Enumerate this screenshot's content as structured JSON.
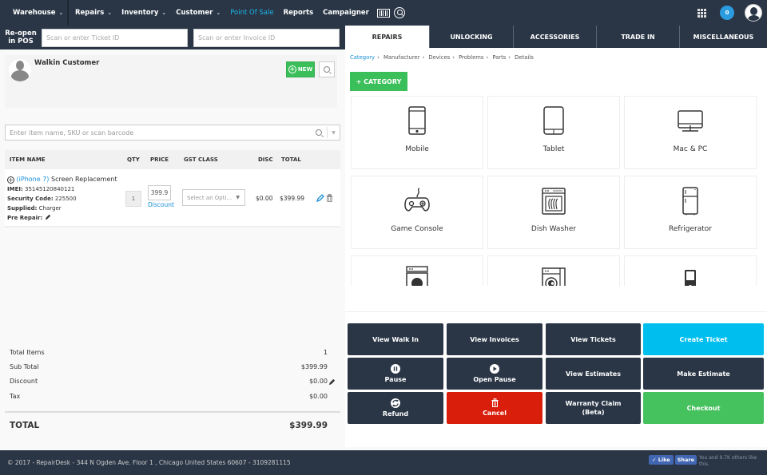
{
  "topnav": {
    "warehouse": "Warehouse",
    "items": [
      {
        "label": "Repairs",
        "dropdown": true
      },
      {
        "label": "Inventory",
        "dropdown": true
      },
      {
        "label": "Customer",
        "dropdown": true
      },
      {
        "label": "Point Of Sale",
        "dropdown": false,
        "active": true
      },
      {
        "label": "Reports",
        "dropdown": false
      },
      {
        "label": "Campaigner",
        "dropdown": false
      }
    ],
    "notification_count": "0",
    "icons": [
      "barcode-icon",
      "search-icon",
      "apps-grid-icon",
      "user-avatar-icon"
    ]
  },
  "reopen": {
    "label_line1": "Re-open",
    "label_line2": "in POS",
    "ticket_placeholder": "Scan or enter Ticket ID",
    "ticket_value": "",
    "invoice_placeholder": "Scan or enter Invoice ID",
    "invoice_value": ""
  },
  "customer": {
    "name": "Walkin Customer",
    "new_label": "NEW"
  },
  "item_search": {
    "placeholder": "Enter item name, SKU or scan barcode",
    "value": ""
  },
  "table": {
    "headers": {
      "item_name": "ITEM NAME",
      "qty": "QTY",
      "price": "PRICE",
      "gst_class": "GST CLASS",
      "disc": "DISC",
      "total": "TOTAL"
    },
    "rows": [
      {
        "device": "(iPhone 7)",
        "service": "Screen Replacement",
        "imei_label": "IMEI:",
        "imei": "35145120840121",
        "security_label": "Security Code:",
        "security": "225500",
        "supplied_label": "Supplied:",
        "supplied": "Charger",
        "prerepair_label": "Pre Repair:",
        "qty": "1",
        "price": "399.9",
        "discount_link": "Discount",
        "gst_placeholder": "Select an Opti...",
        "disc": "$0.00",
        "total": "$399.99"
      }
    ]
  },
  "totals": {
    "total_items_label": "Total Items",
    "total_items": "1",
    "sub_total_label": "Sub Total",
    "sub_total": "$399.99",
    "discount_label": "Discount",
    "discount": "$0.00",
    "tax_label": "Tax",
    "tax": "$0.00",
    "grand_total_label": "TOTAL",
    "grand_total": "$399.99"
  },
  "tabs": [
    {
      "label": "REPAIRS",
      "active": true
    },
    {
      "label": "UNLOCKING"
    },
    {
      "label": "ACCESSORIES"
    },
    {
      "label": "TRADE IN"
    },
    {
      "label": "MISCELLANEOUS"
    }
  ],
  "breadcrumb": [
    "Category",
    "Manufacturer",
    "Devices",
    "Problems",
    "Parts",
    "Details"
  ],
  "category_button": "+ CATEGORY",
  "categories": [
    {
      "label": "Mobile",
      "icon": "mobile-icon"
    },
    {
      "label": "Tablet",
      "icon": "tablet-icon"
    },
    {
      "label": "Mac & PC",
      "icon": "desktop-icon"
    },
    {
      "label": "Game Console",
      "icon": "gamepad-icon"
    },
    {
      "label": "Dish Washer",
      "icon": "dishwasher-icon"
    },
    {
      "label": "Refrigerator",
      "icon": "refrigerator-icon"
    },
    {
      "label": "",
      "icon": "dryer-icon"
    },
    {
      "label": "",
      "icon": "washing-machine-icon"
    },
    {
      "label": "",
      "icon": "music-player-icon"
    }
  ],
  "actions": [
    {
      "label": "View Walk In"
    },
    {
      "label": "View Invoices"
    },
    {
      "label": "View Tickets"
    },
    {
      "label": "Create Ticket",
      "color": "#00bfee"
    },
    {
      "label": "Pause",
      "icon": "pause-icon"
    },
    {
      "label": "Open Pause",
      "icon": "play-icon"
    },
    {
      "label": "View Estimates"
    },
    {
      "label": "Make Estimate"
    },
    {
      "label": "Refund",
      "icon": "refund-icon"
    },
    {
      "label": "Cancel",
      "icon": "trash-icon",
      "color": "#d91f0b"
    },
    {
      "label": "Warranty Claim\n(Beta)",
      "line1": "Warranty Claim",
      "line2": "(Beta)"
    },
    {
      "label": "Checkout",
      "color": "#45c15e"
    }
  ],
  "footer": {
    "text": "© 2017 - RepairDesk - 344 N Ogden Ave. Floor 1 , Chicago United States 60607 - 3109281115",
    "fb_like": "✓ Like",
    "fb_share": "Share",
    "fb_text": "You and 9.7K others like this."
  },
  "colors": {
    "navy": "#2a3646",
    "accent_blue": "#1ab4e8",
    "green": "#3bbf5a",
    "cyan": "#00bfee",
    "red": "#d91f0b"
  }
}
